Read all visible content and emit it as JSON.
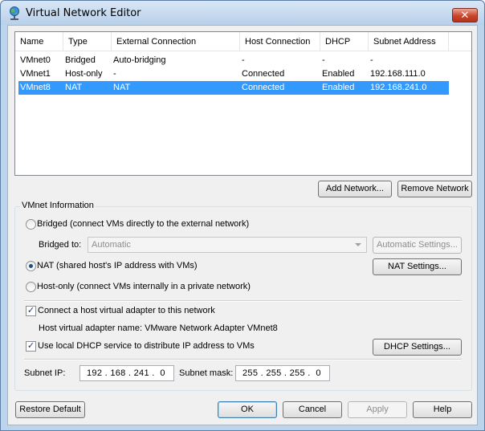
{
  "window": {
    "title": "Virtual Network Editor",
    "close_label": "✕"
  },
  "list": {
    "columns": [
      "Name",
      "Type",
      "External Connection",
      "Host Connection",
      "DHCP",
      "Subnet Address"
    ],
    "rows": [
      [
        "VMnet0",
        "Bridged",
        "Auto-bridging",
        "-",
        "-",
        "-"
      ],
      [
        "VMnet1",
        "Host-only",
        "-",
        "Connected",
        "Enabled",
        "192.168.111.0"
      ],
      [
        "VMnet8",
        "NAT",
        "NAT",
        "Connected",
        "Enabled",
        "192.168.241.0"
      ]
    ],
    "selected_index": 2
  },
  "buttons": {
    "add_network": "Add Network...",
    "remove_network": "Remove Network",
    "auto_settings": "Automatic Settings...",
    "nat_settings": "NAT Settings...",
    "dhcp_settings": "DHCP Settings...",
    "restore_default": "Restore Default",
    "ok": "OK",
    "cancel": "Cancel",
    "apply": "Apply",
    "help": "Help"
  },
  "vmnet_info": {
    "group_label": "VMnet Information",
    "bridged_label": "Bridged (connect VMs directly to the external network)",
    "bridged_to_label": "Bridged to:",
    "bridged_to_value": "Automatic",
    "nat_label": "NAT (shared host's IP address with VMs)",
    "hostonly_label": "Host-only (connect VMs internally in a private network)",
    "selected_mode": "nat",
    "connect_adapter_label": "Connect a host virtual adapter to this network",
    "connect_adapter_checked": true,
    "adapter_name_text": "Host virtual adapter name: VMware Network Adapter VMnet8",
    "dhcp_label": "Use local DHCP service to distribute IP address to VMs",
    "dhcp_checked": true,
    "subnet_ip_label": "Subnet IP:",
    "subnet_ip_value": "192 . 168 . 241 .  0",
    "subnet_mask_label": "Subnet mask:",
    "subnet_mask_value": "255 . 255 . 255 .  0"
  },
  "icons": {
    "title": "network-globe-icon",
    "check": "✓"
  },
  "colors": {
    "selection": "#3399ff",
    "close": "#c9452c"
  }
}
